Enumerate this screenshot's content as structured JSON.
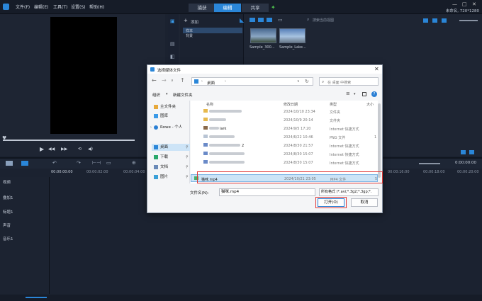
{
  "app": {
    "menus": [
      "文件(F)",
      "编辑(E)",
      "工具(T)",
      "设置(S)",
      "帮助(H)"
    ],
    "mode_tabs": [
      "捕获",
      "编辑",
      "共享"
    ],
    "project_info": "未命名, 720*1280"
  },
  "library": {
    "add_label": "添加",
    "folders": [
      "样本",
      "背景"
    ],
    "search_placeholder": "搜索当前视图",
    "thumbnails": [
      "Sample_300...",
      "Sample_Lake..."
    ]
  },
  "timeline": {
    "timecode_left": "00:00:00:00",
    "ruler": [
      "00:00:00:00",
      "00:00:02:00",
      "00:00:04:00",
      "00:00:16:00",
      "00:00:18:00",
      "00:00:20:00"
    ],
    "timecode_right": "0:00:00:00",
    "tracks": [
      "视频",
      "叠加1",
      "标题1",
      "声音",
      "音乐1"
    ]
  },
  "dialog": {
    "title": "选择媒体文件",
    "breadcrumb": "桌面",
    "search_placeholder": "在 桌面 中搜索",
    "organize_label": "组织",
    "new_folder_label": "新建文件夹",
    "nav_items": [
      "主文件夹",
      "图库",
      "Rowe - 个人",
      "桌面",
      "下载",
      "文档",
      "图片"
    ],
    "columns": [
      "名称",
      "修改日期",
      "类型",
      "大小"
    ],
    "files": [
      {
        "name": "",
        "date": "2024/10/10 23:34",
        "type": "文件夹",
        "size": "",
        "kind": "folder"
      },
      {
        "name": "",
        "date": "2024/10/9 20:14",
        "type": "文件夹",
        "size": "",
        "kind": "folder"
      },
      {
        "name": "lark",
        "date": "2024/9/5 17:20",
        "type": "Internet 快捷方式",
        "size": "",
        "kind": "link"
      },
      {
        "name": "",
        "date": "2024/6/22 10:46",
        "type": "PNG 文件",
        "size": "1",
        "kind": "png"
      },
      {
        "name": "2",
        "date": "2024/8/30 21:57",
        "type": "Internet 快捷方式",
        "size": "",
        "kind": "link"
      },
      {
        "name": "",
        "date": "2024/8/30 15:07",
        "type": "Internet 快捷方式",
        "size": "",
        "kind": "link"
      },
      {
        "name": "",
        "date": "2024/8/30 15:07",
        "type": "Internet 快捷方式",
        "size": "",
        "kind": "link"
      },
      {
        "name": "猫咪.mp4",
        "date": "2024/10/21 23:05",
        "type": "MP4 文件",
        "size": "5",
        "kind": "mp4"
      }
    ],
    "filename_label": "文件名(N):",
    "filename_value": "猫咪.mp4",
    "filter_value": "所有格式 (*.avi;*.3g2;*.3gp;*.",
    "open_label": "打开(O)",
    "cancel_label": "取消"
  },
  "colors": {
    "accent": "#2a86d8",
    "highlight": "#e03a3a",
    "selection": "#cce4f7"
  }
}
